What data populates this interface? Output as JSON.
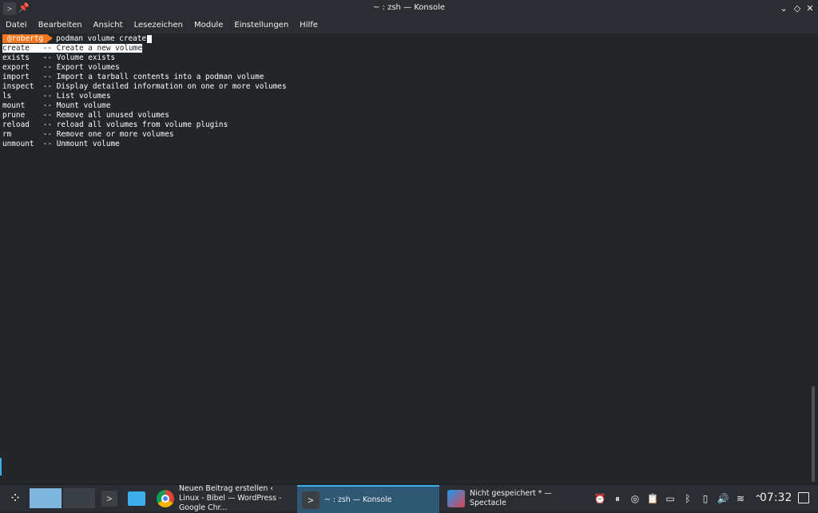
{
  "window": {
    "title": "~ : zsh — Konsole",
    "icons": [
      "konsole-icon",
      "pin-icon",
      "minimize-icon",
      "maximize-icon",
      "close-icon"
    ]
  },
  "menu": [
    "Datei",
    "Bearbeiten",
    "Ansicht",
    "Lesezeichen",
    "Module",
    "Einstellungen",
    "Hilfe"
  ],
  "terminal": {
    "prompt_user": "@robertg",
    "command": "podman volume create",
    "lines": [
      "create   -- Create a new volume",
      "exists   -- Volume exists",
      "export   -- Export volumes",
      "import   -- Import a tarball contents into a podman volume",
      "inspect  -- Display detailed information on one or more volumes",
      "ls       -- List volumes",
      "mount    -- Mount volume",
      "prune    -- Remove all unused volumes",
      "reload   -- reload all volumes from volume plugins",
      "rm       -- Remove one or more volumes",
      "unmount  -- Unmount volume"
    ],
    "highlighted_line": 0,
    "colors": {
      "background": "#232629",
      "prompt_badge": "#f47720",
      "text": "#fcfcfc"
    }
  },
  "taskbar": {
    "launcher_icon": "kde-launcher-icon",
    "tasks": [
      {
        "label": "Neuen Beitrag erstellen ‹ Linux - Bibel — WordPress - Google Chr...",
        "icon": "chrome-icon"
      },
      {
        "label": "~ : zsh — Konsole",
        "icon": "konsole-icon",
        "active": true
      },
      {
        "label": "Nicht gespeichert * — Spectacle",
        "icon": "spectacle-icon"
      }
    ],
    "tray_icons": [
      "notification-icon",
      "media-pause-icon",
      "vault-icon",
      "clipboard-icon",
      "battery-icon",
      "bluetooth-icon",
      "phone-icon",
      "volume-icon",
      "wifi-icon",
      "expand-tray-icon"
    ],
    "clock": "07:32",
    "accent": "#3daee9"
  }
}
